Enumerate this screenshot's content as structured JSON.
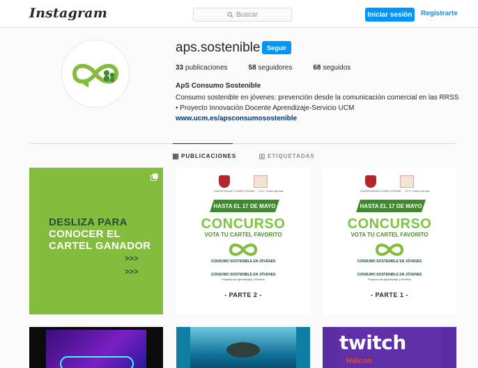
{
  "nav": {
    "logo": "Instagram",
    "search_placeholder": "Buscar",
    "login_label": "Iniciar sesión",
    "register_label": "Regístrarte"
  },
  "profile": {
    "username": "aps.sostenible",
    "follow_label": "Seguir",
    "stats": [
      {
        "count": "33",
        "label": "publicaciones"
      },
      {
        "count": "58",
        "label": "seguidores"
      },
      {
        "count": "68",
        "label": "seguidos"
      }
    ],
    "full_name": "ApS Consumo Sostenible",
    "bio": "Consumo sostenible en jóvenes: prevención desde la comunicación comercial en las RRSS • Proyecto Innovación Docente Aprendizaje-Servicio UCM",
    "url": "www.ucm.es/apsconsumosostenible"
  },
  "tabs": [
    {
      "label": "PUBLICACIONES",
      "active": true
    },
    {
      "label": "ETIQUETADAS",
      "active": false
    }
  ],
  "posts": {
    "slide": {
      "line1": "DESLIZA PARA",
      "line2": "CONOCER EL",
      "line3": "CARTEL GANADOR",
      "arrows1": ">>>",
      "arrows2": ">>>"
    },
    "posters": [
      {
        "crest_label": "UNIVERSIDAD COMPLUTENSE",
        "school_label": "I.E.S. Pablo Neruda",
        "banner": "HASTA EL 17 DE MAYO",
        "title": "CONCURSO",
        "subtitle": "VOTA TU CARTEL FAVORITO",
        "line1": "CONSUMO SOSTENIBLE EN JÓVENES",
        "line2": "CONSUMO SOSTENIBLE EN JÓVENES",
        "line3": "Proyecto de Aprendizaje y Servicio",
        "part": "- PARTE 2 -"
      },
      {
        "crest_label": "UNIVERSIDAD COMPLUTENSE",
        "school_label": "I.E.S. Pablo Neruda",
        "banner": "HASTA EL 17 DE MAYO",
        "title": "CONCURSO",
        "subtitle": "VOTA TU CARTEL FAVORITO",
        "line1": "CONSUMO SOSTENIBLE EN JÓVENES",
        "line2": "CONSUMO SOSTENIBLE EN JÓVENES",
        "line3": "Proyecto de Aprendizaje y Servicio",
        "part": "- PARTE 1 -"
      }
    ],
    "twitch": {
      "word": "twitch",
      "sub": "Halcon"
    }
  },
  "colors": {
    "accent": "#0095f6",
    "brand_green": "#84bd3e",
    "dark_green": "#21513a"
  }
}
